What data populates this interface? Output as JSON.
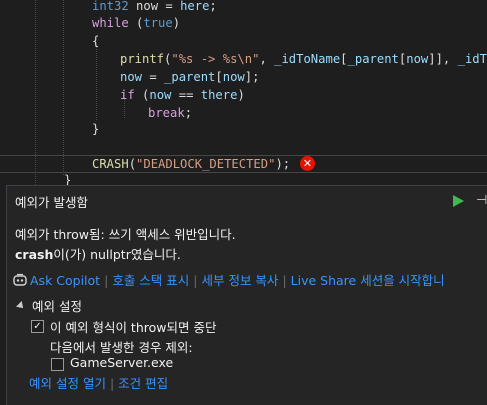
{
  "editor": {
    "lines": [
      {
        "indent": 92,
        "parts": [
          [
            "kw",
            "int32"
          ],
          [
            "txt",
            " now = "
          ],
          [
            "id",
            "here"
          ],
          [
            "txt",
            ";"
          ]
        ]
      },
      {
        "indent": 92,
        "parts": [
          [
            "kw2",
            "while"
          ],
          [
            "txt",
            " ("
          ],
          [
            "kw",
            "true"
          ],
          [
            "txt",
            ")"
          ]
        ]
      },
      {
        "indent": 92,
        "parts": [
          [
            "txt",
            "{"
          ]
        ]
      },
      {
        "indent": 120,
        "parts": [
          [
            "fn",
            "printf"
          ],
          [
            "txt",
            "("
          ],
          [
            "str",
            "\"%s -> %s\\n\""
          ],
          [
            "txt",
            ", "
          ],
          [
            "id",
            "_idToName"
          ],
          [
            "txt",
            "["
          ],
          [
            "id",
            "_parent"
          ],
          [
            "txt",
            "["
          ],
          [
            "id",
            "now"
          ],
          [
            "txt",
            "]], "
          ],
          [
            "id",
            "_idToN"
          ]
        ]
      },
      {
        "indent": 120,
        "parts": [
          [
            "id",
            "now"
          ],
          [
            "txt",
            " = "
          ],
          [
            "id",
            "_parent"
          ],
          [
            "txt",
            "["
          ],
          [
            "id",
            "now"
          ],
          [
            "txt",
            "];"
          ]
        ]
      },
      {
        "indent": 120,
        "parts": [
          [
            "kw2",
            "if"
          ],
          [
            "txt",
            " ("
          ],
          [
            "id",
            "now"
          ],
          [
            "txt",
            " == "
          ],
          [
            "id",
            "there"
          ],
          [
            "txt",
            ")"
          ]
        ]
      },
      {
        "indent": 148,
        "parts": [
          [
            "kw2",
            "break"
          ],
          [
            "txt",
            ";"
          ]
        ]
      },
      {
        "indent": 92,
        "parts": [
          [
            "txt",
            "}"
          ]
        ]
      },
      {
        "indent": 0,
        "parts": []
      },
      {
        "indent": 92,
        "parts": [
          [
            "fn",
            "CRASH"
          ],
          [
            "txt",
            "("
          ],
          [
            "str",
            "\"DEADLOCK_DETECTED\""
          ],
          [
            "txt",
            ");"
          ]
        ]
      },
      {
        "indent": 64,
        "parts": [
          [
            "txt",
            "}"
          ]
        ]
      }
    ],
    "error_glyph": "✕"
  },
  "exception": {
    "title": "예외가 발생함",
    "message_line1": "예외가 throw됨: 쓰기 액세스 위반입니다.",
    "message_line2_bold": "crash",
    "message_line2_rest": "이(가) nullptr였습니다.",
    "links": [
      "Ask Copilot",
      "호출 스택 표시",
      "세부 정보 복사",
      "Live Share 세션을 시작합니"
    ],
    "settings": {
      "header": "예외 설정",
      "break_option_label": "이 예외 형식이 throw되면 중단",
      "break_option_checked": true,
      "except_label": "다음에서 발생한 경우 제외:",
      "module_label": "GameServer.exe",
      "module_checked": false
    },
    "bottom_links": [
      "예외 설정 열기",
      "조건 편집"
    ]
  },
  "colors": {
    "accent_link": "#3794ff",
    "error_red": "#e51400",
    "continue_green": "#3fb950"
  }
}
